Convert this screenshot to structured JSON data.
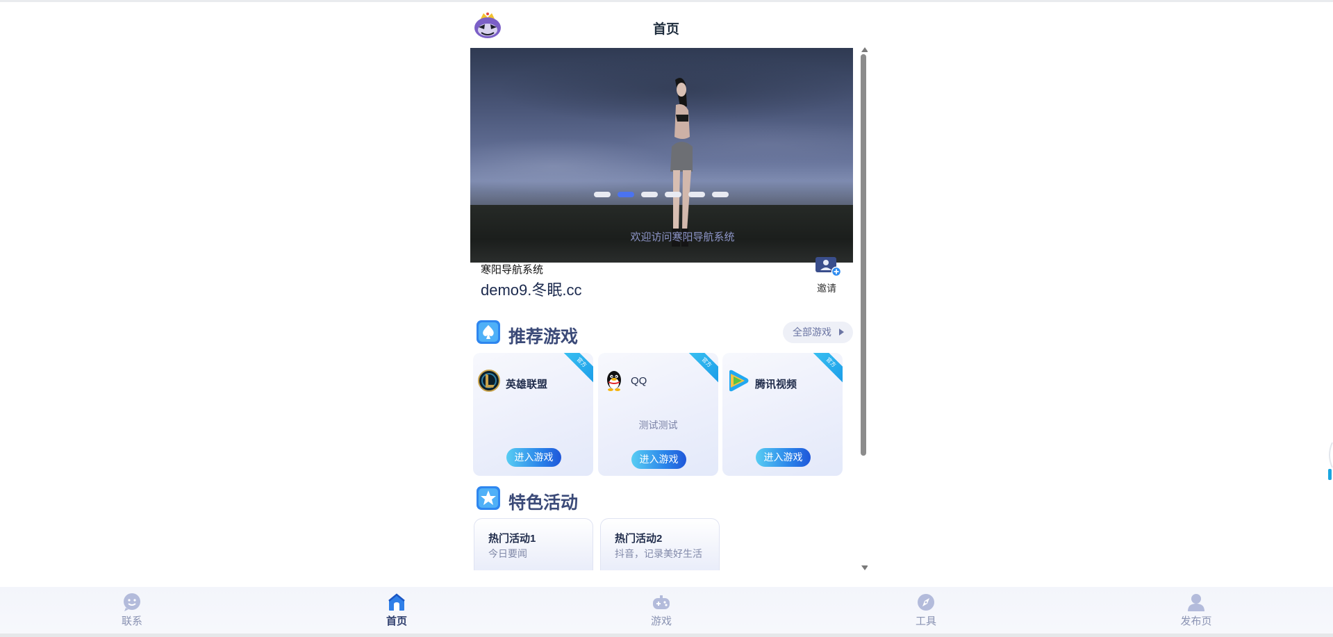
{
  "header": {
    "title": "首页",
    "logo_icon": "crowned-mascot-logo-icon"
  },
  "banner": {
    "caption": "欢迎访问寒阳导航系统",
    "dot_count": 6,
    "active_dot": 2
  },
  "site": {
    "name": "寒阳导航系统",
    "domain": "demo9.冬眠.cc",
    "invite_label": "邀请",
    "invite_icon": "user-add-icon"
  },
  "games_section": {
    "title": "推荐游戏",
    "all_label": "全部游戏",
    "icon": "spade-icon",
    "games": [
      {
        "name": "英雄联盟",
        "desc": "",
        "button": "进入游戏",
        "ribbon": "官方",
        "icon": "league-of-legends-icon"
      },
      {
        "name": "QQ",
        "desc": "测试测试",
        "button": "进入游戏",
        "ribbon": "官方",
        "icon": "qq-penguin-icon"
      },
      {
        "name": "腾讯视频",
        "desc": "",
        "button": "进入游戏",
        "ribbon": "官方",
        "icon": "tencent-video-icon"
      }
    ]
  },
  "activities_section": {
    "title": "特色活动",
    "icon": "star-icon",
    "items": [
      {
        "title": "热门活动1",
        "subtitle": "今日要闻"
      },
      {
        "title": "热门活动2",
        "subtitle": "抖音，记录美好生活"
      }
    ]
  },
  "tabbar": {
    "items": [
      {
        "label": "联系",
        "icon": "smiley-chat-icon",
        "active": false
      },
      {
        "label": "首页",
        "icon": "home-icon",
        "active": true
      },
      {
        "label": "游戏",
        "icon": "gamepad-icon",
        "active": false
      },
      {
        "label": "工具",
        "icon": "compass-icon",
        "active": false
      },
      {
        "label": "发布页",
        "icon": "user-icon",
        "active": false
      }
    ]
  },
  "colors": {
    "accent": "#4b73f0",
    "title": "#3b4a78",
    "button_start": "#58cdf3",
    "button_end": "#1f57d9"
  }
}
